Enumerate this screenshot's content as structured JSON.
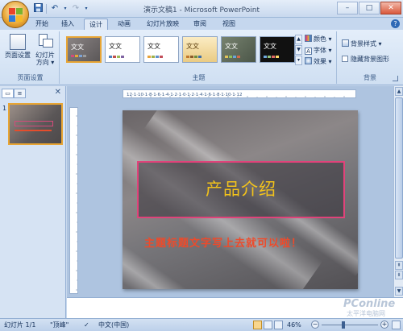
{
  "window": {
    "title": "演示文稿1 - Microsoft PowerPoint"
  },
  "quick_access": {
    "save_icon": "save-icon",
    "undo_icon": "undo-icon",
    "redo_icon": "redo-icon"
  },
  "window_controls": {
    "minimize": "–",
    "maximize": "□",
    "close": "✕"
  },
  "tabs": [
    {
      "label": "开始"
    },
    {
      "label": "插入"
    },
    {
      "label": "设计"
    },
    {
      "label": "动画"
    },
    {
      "label": "幻灯片放映"
    },
    {
      "label": "审阅"
    },
    {
      "label": "视图"
    }
  ],
  "active_tab": "设计",
  "ribbon": {
    "page_setup": {
      "label": "页面设置",
      "page_setup_btn": "页面设置",
      "orientation_btn_line1": "幻灯片",
      "orientation_btn_line2": "方向 ▾"
    },
    "themes": {
      "label": "主题",
      "items": [
        {
          "label": "文文",
          "bg": "#6b6868",
          "fg": "#ffffff",
          "selected": true
        },
        {
          "label": "文文",
          "bg": "#ffffff",
          "fg": "#222222",
          "selected": false
        },
        {
          "label": "文文",
          "bg": "#ffffff",
          "fg": "#222222",
          "selected": false
        },
        {
          "label": "文文",
          "bg": "#f6e3b0",
          "fg": "#5a3b0c",
          "selected": false
        },
        {
          "label": "文文",
          "bg": "#5f6b5b",
          "fg": "#ffffff",
          "selected": false
        },
        {
          "label": "文文",
          "bg": "#101010",
          "fg": "#ffffff",
          "selected": false
        }
      ],
      "colors_btn": "颜色 ▾",
      "fonts_btn": "字体 ▾",
      "effects_btn": "效果 ▾"
    },
    "background": {
      "label": "背景",
      "styles_btn": "背景样式 ▾",
      "hide_graphics": "隐藏背景图形"
    }
  },
  "slide_panel": {
    "slide_number": "1",
    "close_icon": "✕"
  },
  "slide": {
    "title": "产品介绍"
  },
  "annotation": "主题标题文字写上去就可以啦！",
  "watermark": {
    "main": "PConline",
    "sub": "太平洋电脑网"
  },
  "ruler": {
    "h_labels": "12·1·10·1·8·1·6·1·4·1·2·1·0·1·2·1·4·1·6·1·8·1·10·1·12"
  },
  "statusbar": {
    "slide_info": "幻灯片 1/1",
    "theme_name": "\"顶峰\"",
    "language": "中文(中国)",
    "zoom": "46%"
  },
  "colors": {
    "accent": "#e8a534",
    "title_text": "#f2c21b",
    "title_border": "#e0437a",
    "annotation": "#ee4a2a"
  }
}
